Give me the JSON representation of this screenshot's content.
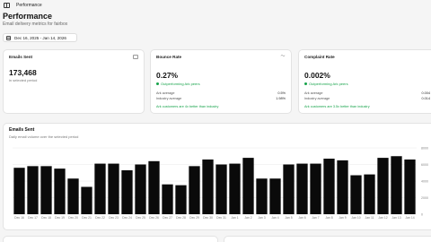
{
  "topbar": {
    "title": "Performance",
    "toggle_icon": "sidebar-toggle-icon"
  },
  "page": {
    "title": "Performance",
    "subtitle": "Email delivery metrics for fairbox"
  },
  "date_range": {
    "label": "Dec 16, 2025 - Jan 14, 2026",
    "icon": "calendar-icon"
  },
  "cards": {
    "emails_sent": {
      "title": "Emails Sent",
      "value": "173,468",
      "note": "in selected period",
      "icon": "mail-icon"
    },
    "bounce_rate": {
      "title": "Bounce Rate",
      "value": "0.27%",
      "icon": "trend-icon",
      "benchmark": "Outperforming Ark peers",
      "ark_label": "Ark average",
      "ark_value": "0.5%",
      "industry_label": "Industry average",
      "industry_value": "1.98%",
      "note": "Ark customers are 4x better than industry"
    },
    "complaint_rate": {
      "title": "Complaint Rate",
      "value": "0.002%",
      "icon": "alert-icon",
      "benchmark": "Outperforming Ark peers",
      "ark_label": "Ark average",
      "ark_value": "0.004",
      "industry_label": "Industry average",
      "industry_value": "0.014",
      "note": "Ark customers are 3.5x better than industry"
    }
  },
  "chart_section": {
    "title": "Emails Sent",
    "subtitle": "Daily email volume over the selected period"
  },
  "chart_data": {
    "type": "bar",
    "title": "Emails Sent",
    "subtitle": "Daily email volume over the selected period",
    "categories": [
      "Dec 16",
      "Dec 17",
      "Dec 18",
      "Dec 19",
      "Dec 20",
      "Dec 21",
      "Dec 22",
      "Dec 23",
      "Dec 24",
      "Dec 25",
      "Dec 26",
      "Dec 27",
      "Dec 28",
      "Dec 29",
      "Dec 30",
      "Dec 31",
      "Jan 1",
      "Jan 2",
      "Jan 3",
      "Jan 4",
      "Jan 5",
      "Jan 6",
      "Jan 7",
      "Jan 8",
      "Jan 9",
      "Jan 10",
      "Jan 11",
      "Jan 12",
      "Jan 13",
      "Jan 14"
    ],
    "tick_labels": [
      "Dec 16",
      "Dec 17",
      "Dec 18",
      "Dec 19",
      "Dec 20",
      "Dec 21",
      "Dec 22",
      "Dec 23",
      "Dec 24",
      "Dec 25",
      "Dec 26",
      "Dec 27",
      "Dec 28",
      "Dec 29",
      "Dec 30",
      "Dec 31",
      "Jan 1",
      "Jan 2",
      "Jan 3",
      "Jan 4",
      "Jan 5",
      "Jan 6",
      "Jan 7",
      "Jan 8",
      "Jan 9",
      "Jan 10",
      "Jan 11",
      "Jan 12",
      "Jan 13",
      "Jan 14"
    ],
    "values": [
      5600,
      5800,
      5800,
      5500,
      4300,
      3300,
      6100,
      6100,
      5300,
      6000,
      6400,
      3600,
      3500,
      5800,
      6600,
      6000,
      6100,
      6800,
      4300,
      4300,
      6000,
      6100,
      6100,
      6700,
      6500,
      4700,
      4800,
      6800,
      7000,
      6600
    ],
    "y_ticks": [
      "8000",
      "6000",
      "4000",
      "2000",
      "0"
    ],
    "ylim": [
      0,
      8000
    ],
    "grid": true,
    "bar_color": "#0a0a0a"
  }
}
